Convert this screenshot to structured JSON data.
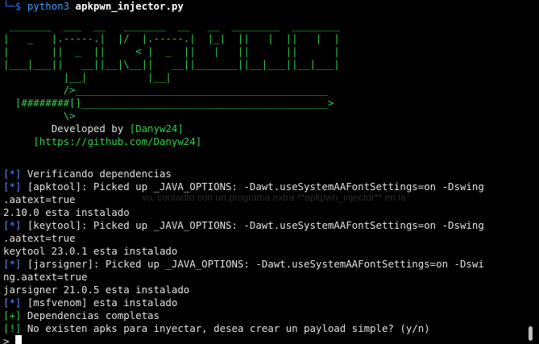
{
  "terminal": {
    "prompt_symbol": "└─$",
    "command": "python3",
    "script_name": "apkpwn_injector.py",
    "banner_lines": [
      " _______  ___  __   _______  __   __  ________  ________",
      "|   _   |.-----.|  |/  |.-----.|  |_|  ||   |  ||   |  |",
      "|       ||  _  ||     < |  _  ||   |   ||      ||      |",
      "|___|___||   __||__|\\__||   __||_______||__|___||__|___|",
      "          |__|          |__|",
      "          />__________________________________________",
      "  [########[]_________________________________________>",
      "          \\>"
    ],
    "developer_prefix": "Developed by ",
    "developer_name": "[Danyw24]",
    "developer_url": "[https://github.com/Danyw24]",
    "output": [
      {
        "tag": "[*]",
        "text": " Verificando dependencias"
      },
      {
        "tag": "[*]",
        "text": " [apktool]: Picked up _JAVA_OPTIONS: -Dawt.useSystemAAFontSettings=on -Dswing"
      },
      {
        "tag": "",
        "text": ".aatext=true"
      },
      {
        "tag": "",
        "text": "2.10.0 esta instalado"
      },
      {
        "tag": "[*]",
        "text": " [keytool]: Picked up _JAVA_OPTIONS: -Dawt.useSystemAAFontSettings=on -Dswing"
      },
      {
        "tag": "",
        "text": ".aatext=true"
      },
      {
        "tag": "",
        "text": "keytool 23.0.1 esta instalado"
      },
      {
        "tag": "[*]",
        "text": " [jarsigner]: Picked up _JAVA_OPTIONS: -Dawt.useSystemAAFontSettings=on -Dswi"
      },
      {
        "tag": "",
        "text": "ng.aatext=true"
      },
      {
        "tag": "",
        "text": "jarsigner 21.0.5 esta instalado"
      },
      {
        "tag": "[*]",
        "text": " [msfvenom] esta instalado"
      },
      {
        "tag": "[+]",
        "text": " Dependencias completas"
      },
      {
        "tag": "[!]",
        "text": " No existen apks para inyectar, desea crear un payload simple? (y/n)"
      }
    ],
    "input_prompt": "> ",
    "ghost_text": "vo, contanto con un programa extra **apkpwn_injector** en la"
  },
  "colors": {
    "background": "#000000",
    "text": "#e2e2e2",
    "tag_blue": "#5b8cff",
    "accent_green": "#2fd14a"
  }
}
